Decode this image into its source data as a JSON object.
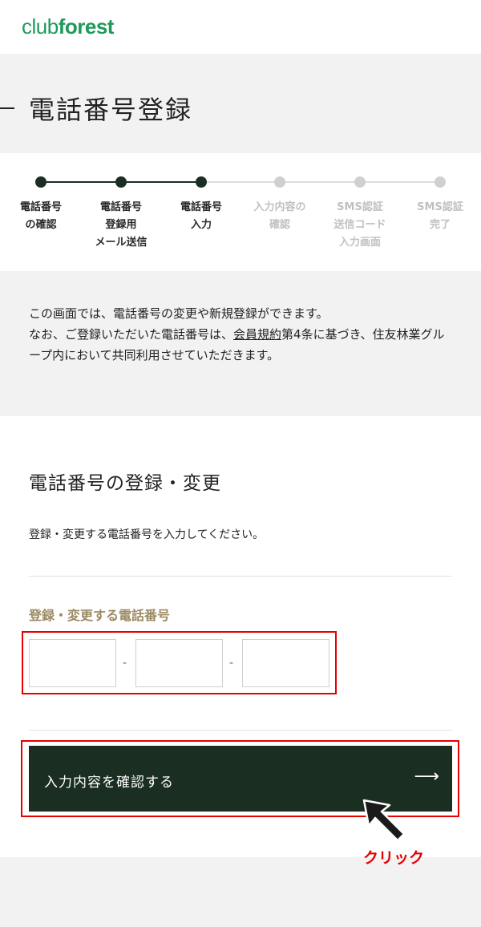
{
  "header": {
    "logo_prefix": "club",
    "logo_suffix": "forest"
  },
  "page": {
    "title": "電話番号登録"
  },
  "steps": [
    {
      "label": "電話番号\nの確認",
      "state": "done"
    },
    {
      "label": "電話番号\n登録用\nメール送信",
      "state": "done"
    },
    {
      "label": "電話番号\n入力",
      "state": "current"
    },
    {
      "label": "入力内容の\n確認",
      "state": "todo"
    },
    {
      "label": "SMS認証\n送信コード\n入力画面",
      "state": "todo"
    },
    {
      "label": "SMS認証\n完了",
      "state": "todo"
    }
  ],
  "intro": {
    "line1": "この画面では、電話番号の変更や新規登録ができます。",
    "line2_before": "なお、ご登録いただいた電話番号は、",
    "link": "会員規約",
    "line2_after": "第4条に基づき、住友林業グループ内において共同利用させていただきます。"
  },
  "form": {
    "title": "電話番号の登録・変更",
    "description": "登録・変更する電話番号を入力してください。",
    "field_label": "登録・変更する電話番号",
    "phone_part1": "",
    "phone_part2": "",
    "phone_part3": "",
    "separator": "-",
    "confirm_label": "入力内容を確認する",
    "confirm_arrow": "⟶"
  },
  "annotation": {
    "click_label": "クリック"
  },
  "colors": {
    "brand_green": "#1f9a5c",
    "dark_green": "#1a2e22",
    "label_gold": "#9c8a64",
    "highlight_red": "#e60000"
  }
}
